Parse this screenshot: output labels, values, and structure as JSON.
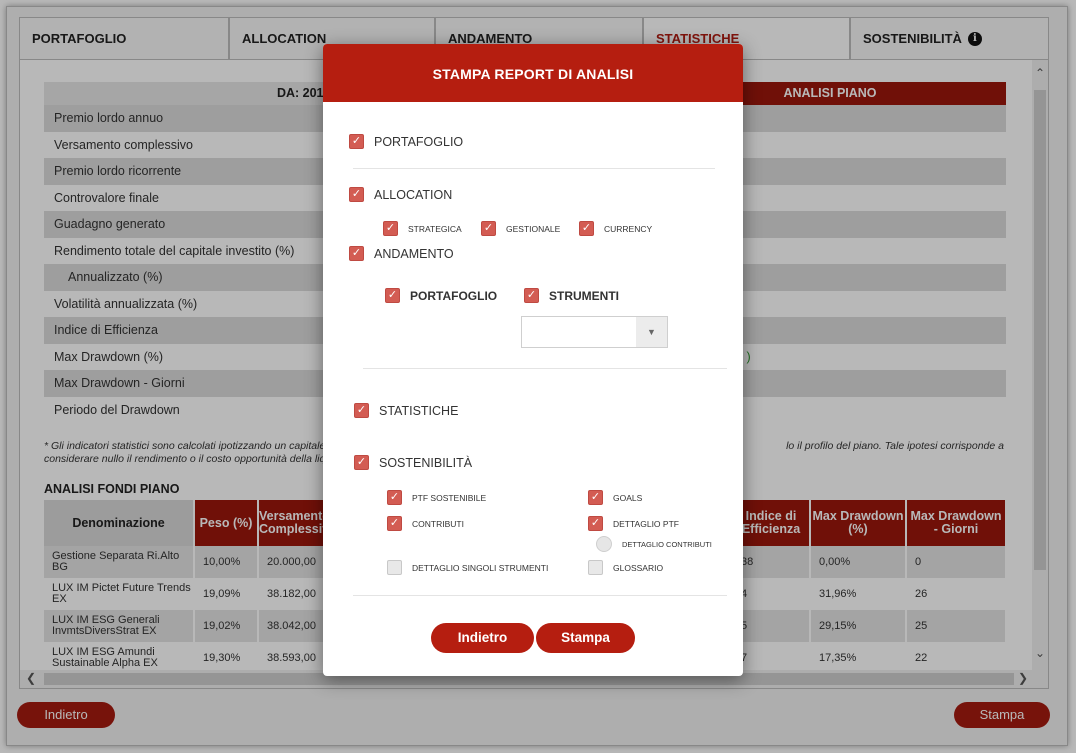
{
  "tabs": [
    {
      "label": "PORTAFOGLIO"
    },
    {
      "label": "ALLOCATION"
    },
    {
      "label": "ANDAMENTO"
    },
    {
      "label": "STATISTICHE"
    },
    {
      "label": "SOSTENIBILITÀ"
    }
  ],
  "stats": {
    "header_left": "DA: 2011-02-08 - A: 2021",
    "header_right": "ANALISI PIANO",
    "rows": [
      "Premio lordo annuo",
      "Versamento complessivo",
      "Premio lordo ricorrente",
      "Controvalore finale",
      "Guadagno generato",
      "Rendimento totale del capitale investito (%)",
      "Annualizzato (%)",
      "Volatilità annualizzata (%)",
      "Indice di Efficienza",
      "Max Drawdown (%)",
      "Max Drawdown - Giorni",
      "Periodo del Drawdown"
    ],
    "max_drawdown_right": "C )"
  },
  "footnote": {
    "left": "* Gli indicatori statistici sono calcolati ipotizzando un capitale i",
    "left2": "considerare nullo il rendimento o il costo opportunità della liqu",
    "right": "lo il profilo del piano. Tale ipotesi corrisponde a"
  },
  "funds": {
    "title": "ANALISI FONDI PIANO",
    "headers": [
      "Denominazione",
      "Peso (%)",
      "Versamento Complessivo",
      "",
      "",
      "",
      "",
      "",
      "Indice di Efficienza",
      "Max Drawdown (%)",
      "Max Drawdown - Giorni"
    ],
    "rows": [
      {
        "name": "Gestione Separata Ri.Alto BG",
        "peso": "10,00%",
        "versamento": "20.000,00",
        "indice": "38",
        "maxdd": "0,00%",
        "giorni": "0"
      },
      {
        "name": "LUX IM Pictet Future Trends EX",
        "peso": "19,09%",
        "versamento": "38.182,00",
        "indice": "4",
        "maxdd": "31,96%",
        "giorni": "26"
      },
      {
        "name": "LUX IM ESG Generali InvmtsDiversStrat EX",
        "peso": "19,02%",
        "versamento": "38.042,00",
        "indice": "5",
        "maxdd": "29,15%",
        "giorni": "25"
      },
      {
        "name": "LUX IM ESG Amundi Sustainable Alpha EX",
        "peso": "19,30%",
        "versamento": "38.593,00",
        "indice": "7",
        "maxdd": "17,35%",
        "giorni": "22"
      }
    ]
  },
  "bottom": {
    "back": "Indietro",
    "print": "Stampa"
  },
  "modal": {
    "title": "STAMPA REPORT DI ANALISI",
    "portafoglio": "PORTAFOGLIO",
    "allocation": "ALLOCATION",
    "strategica": "STRATEGICA",
    "gestionale": "GESTIONALE",
    "currency": "CURRENCY",
    "andamento": "ANDAMENTO",
    "and_portafoglio": "PORTAFOGLIO",
    "and_strumenti": "STRUMENTI",
    "select_value": "",
    "statistiche": "STATISTICHE",
    "sostenibilita": "SOSTENIBILITÀ",
    "ptf_sostenibile": "PTF SOSTENIBILE",
    "goals": "GOALS",
    "contributi": "CONTRIBUTI",
    "dettaglio_ptf": "DETTAGLIO PTF",
    "dettaglio_contributi": "DETTAGLIO CONTRIBUTI",
    "dettaglio_singoli": "DETTAGLIO SINGOLI STRUMENTI",
    "glossario": "GLOSSARIO",
    "back": "Indietro",
    "print": "Stampa"
  },
  "colors": {
    "accent": "#b51e10",
    "header_dark": "#9c170c",
    "checkbox": "#d35c53"
  }
}
